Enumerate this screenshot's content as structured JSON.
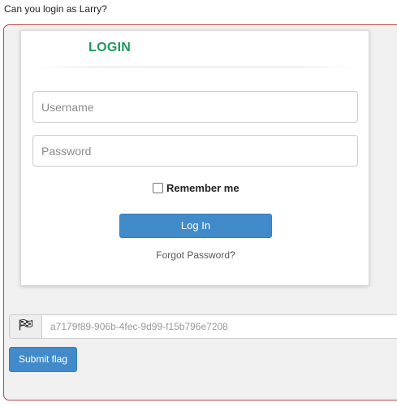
{
  "task": {
    "prompt": "Can you login as Larry?"
  },
  "login_card": {
    "title": "LOGIN",
    "username_placeholder": "Username",
    "password_placeholder": "Password",
    "remember_label": "Remember me",
    "remember_checked": false,
    "login_button": "Log In",
    "forgot_link": "Forgot Password?"
  },
  "flag_form": {
    "flag_icon": "checkered-flag-icon",
    "value": "a7179f89-906b-4fec-9d99-f15b796e7208",
    "submit_label": "Submit flag"
  },
  "colors": {
    "title_green": "#1e9a5a",
    "button_blue": "#428bca",
    "frame_border": "#b94a48",
    "panel_bg": "#f0f0f0"
  }
}
